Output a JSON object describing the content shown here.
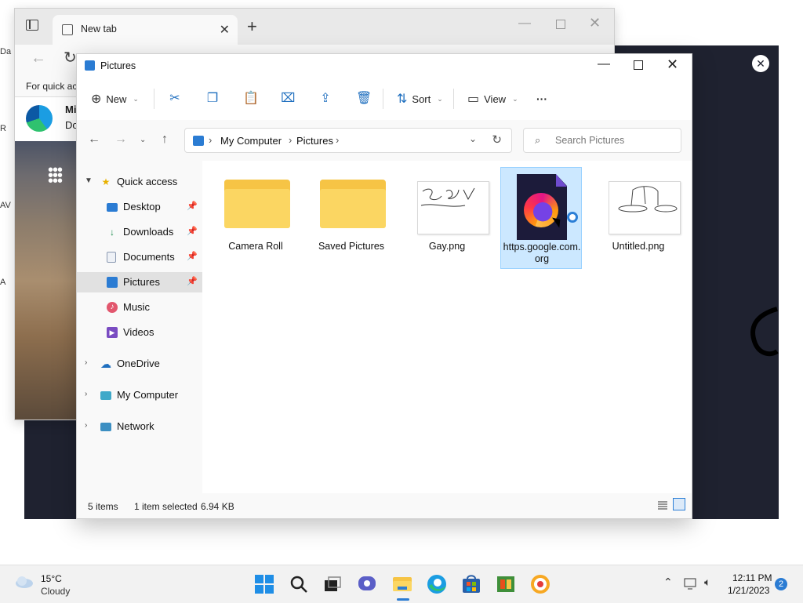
{
  "desktop": {
    "icon_labels": [
      "Da",
      "R",
      "AV",
      "A"
    ]
  },
  "dark_window": {
    "close_glyph": "✕"
  },
  "browser": {
    "tab_title": "New tab",
    "tab_close": "✕",
    "new_tab_glyph": "+",
    "favorites_bar_text": "For quick ac",
    "card_title": "Mi",
    "card_sub": "Do",
    "brand_colors": [
      "#1b9de2",
      "#2fc26f",
      "#0c59a4"
    ]
  },
  "explorer": {
    "title": "Pictures",
    "accent": "#2b7cd3",
    "commands": {
      "new_label": "New",
      "sort_label": "Sort",
      "view_label": "View",
      "more_label": "···"
    },
    "breadcrumb": [
      "My Computer",
      "Pictures"
    ],
    "search_placeholder": "Search Pictures",
    "nav_items": [
      {
        "label": "Quick access",
        "icon": "star-icon"
      },
      {
        "label": "Desktop",
        "icon": "desktop-icon",
        "pinned": true
      },
      {
        "label": "Downloads",
        "icon": "download-icon",
        "pinned": true
      },
      {
        "label": "Documents",
        "icon": "document-icon",
        "pinned": true
      },
      {
        "label": "Pictures",
        "icon": "pictures-icon",
        "pinned": true,
        "selected": true
      },
      {
        "label": "Music",
        "icon": "music-icon"
      },
      {
        "label": "Videos",
        "icon": "videos-icon"
      },
      {
        "label": "OneDrive",
        "icon": "cloud-icon"
      },
      {
        "label": "My Computer",
        "icon": "computer-icon"
      },
      {
        "label": "Network",
        "icon": "network-icon"
      }
    ],
    "files": [
      {
        "name": "Camera Roll",
        "type": "folder"
      },
      {
        "name": "Saved Pictures",
        "type": "folder"
      },
      {
        "name": "Gay.png",
        "type": "image"
      },
      {
        "name": "https.google.com.org",
        "type": "firefox-file",
        "selected": true
      },
      {
        "name": "Untitled.png",
        "type": "image"
      }
    ],
    "status": {
      "items": "5 items",
      "selected": "1 item selected",
      "size": "6.94 KB"
    }
  },
  "taskbar": {
    "weather_temp": "15°C",
    "weather_desc": "Cloudy",
    "time": "12:11 PM",
    "date": "1/21/2023",
    "notification_count": "2"
  }
}
